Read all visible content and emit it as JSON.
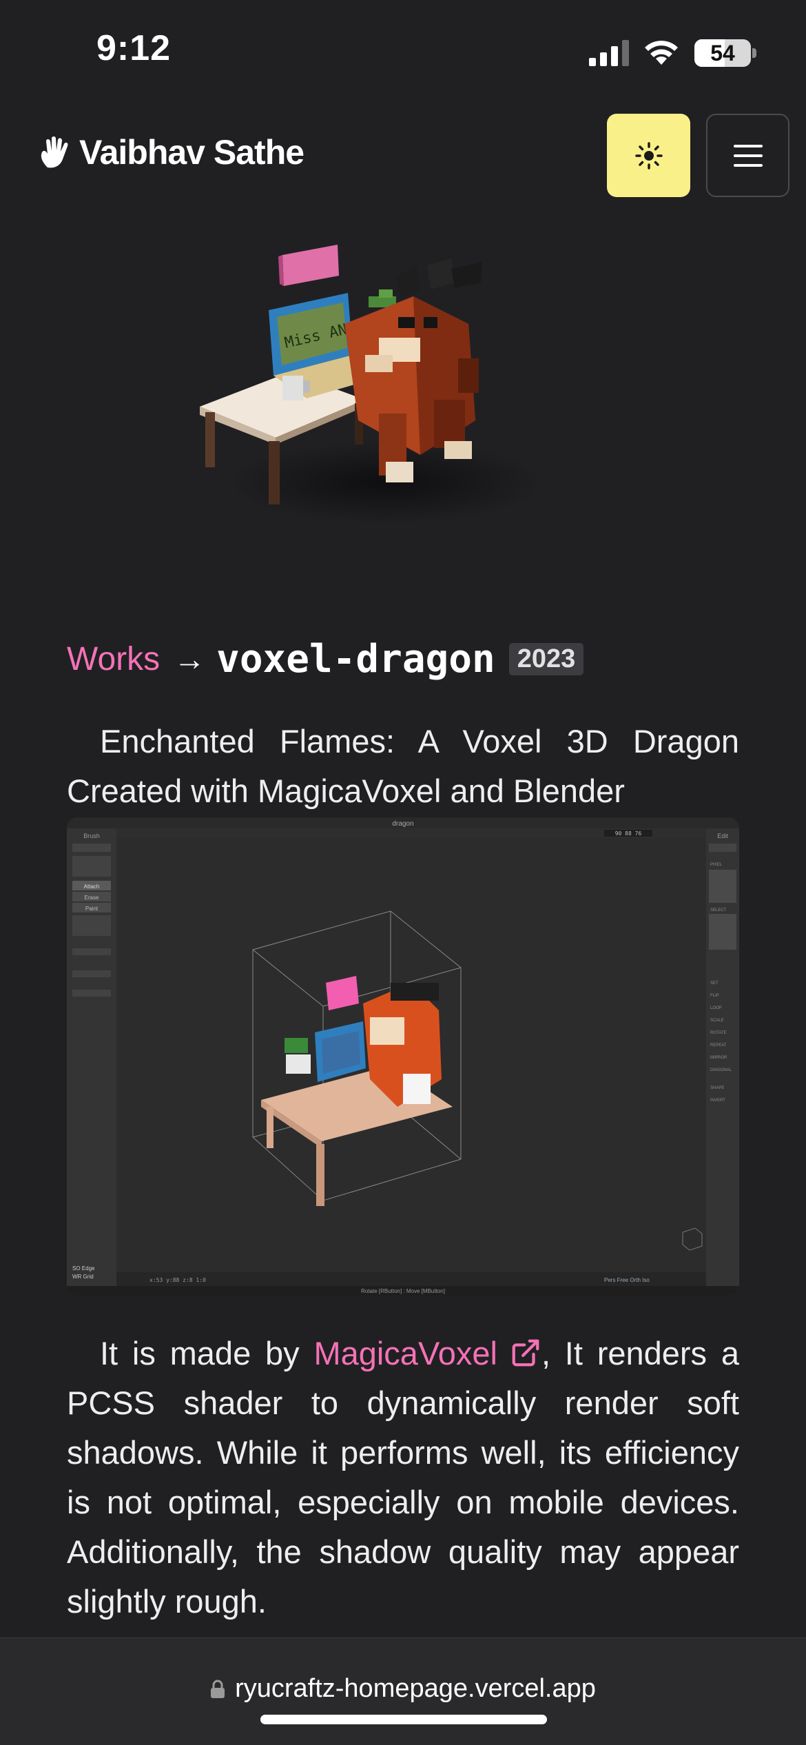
{
  "status_bar": {
    "time": "9:12",
    "battery_level": "54",
    "battery_fraction": 0.54,
    "signal_bars": 3,
    "icons": [
      "cellular-signal-icon",
      "wifi-icon",
      "battery-icon"
    ]
  },
  "header": {
    "site_name": "Vaibhav Sathe",
    "logo_icon": "hand-icon",
    "theme_toggle_icon": "sun-icon",
    "menu_icon": "hamburger-menu-icon"
  },
  "breadcrumb": {
    "parent": "Works",
    "separator": "→",
    "current": "voxel-dragon",
    "year": "2023"
  },
  "content": {
    "intro": "Enchanted Flames: A Voxel 3D Dragon Created with MagicaVoxel and Blender",
    "body_before_link": "It is made by ",
    "link_text": "MagicaVoxel",
    "body_after_link": ", It renders a PCSS shader to dynamically render soft shadows. While it performs well, its efficiency is not optimal, especially on mobile devices. Additionally, the shadow quality may appear slightly rough."
  },
  "editor_screenshot": {
    "window_title": "dragon",
    "left_panel_title": "Brush",
    "right_panel_title": "Edit",
    "dims": "90  88  76",
    "tools": [
      "Attach",
      "Erase",
      "Paint"
    ],
    "right_sections": [
      "PIXEL",
      "SELECT",
      "SET",
      "FLIP",
      "LOOP",
      "SCALE",
      "ROTATE",
      "REPEAT",
      "MIRROR",
      "DIAGONAL",
      "SHAPE",
      "INVERT"
    ],
    "bottom_left": [
      "SO  Edge",
      "WR  Grid"
    ],
    "coords": "x:53  y:88  z:8   1:0",
    "view_modes": "Pers  Free  Orth  Iso",
    "status_hint": "Rotate [RButton] : Move [MButton]"
  },
  "browser": {
    "url": "ryucraftz-homepage.vercel.app",
    "lock_icon": "lock-icon"
  },
  "colors": {
    "background": "#202023",
    "accent_pink": "#f472b6",
    "theme_button": "#faf089"
  }
}
